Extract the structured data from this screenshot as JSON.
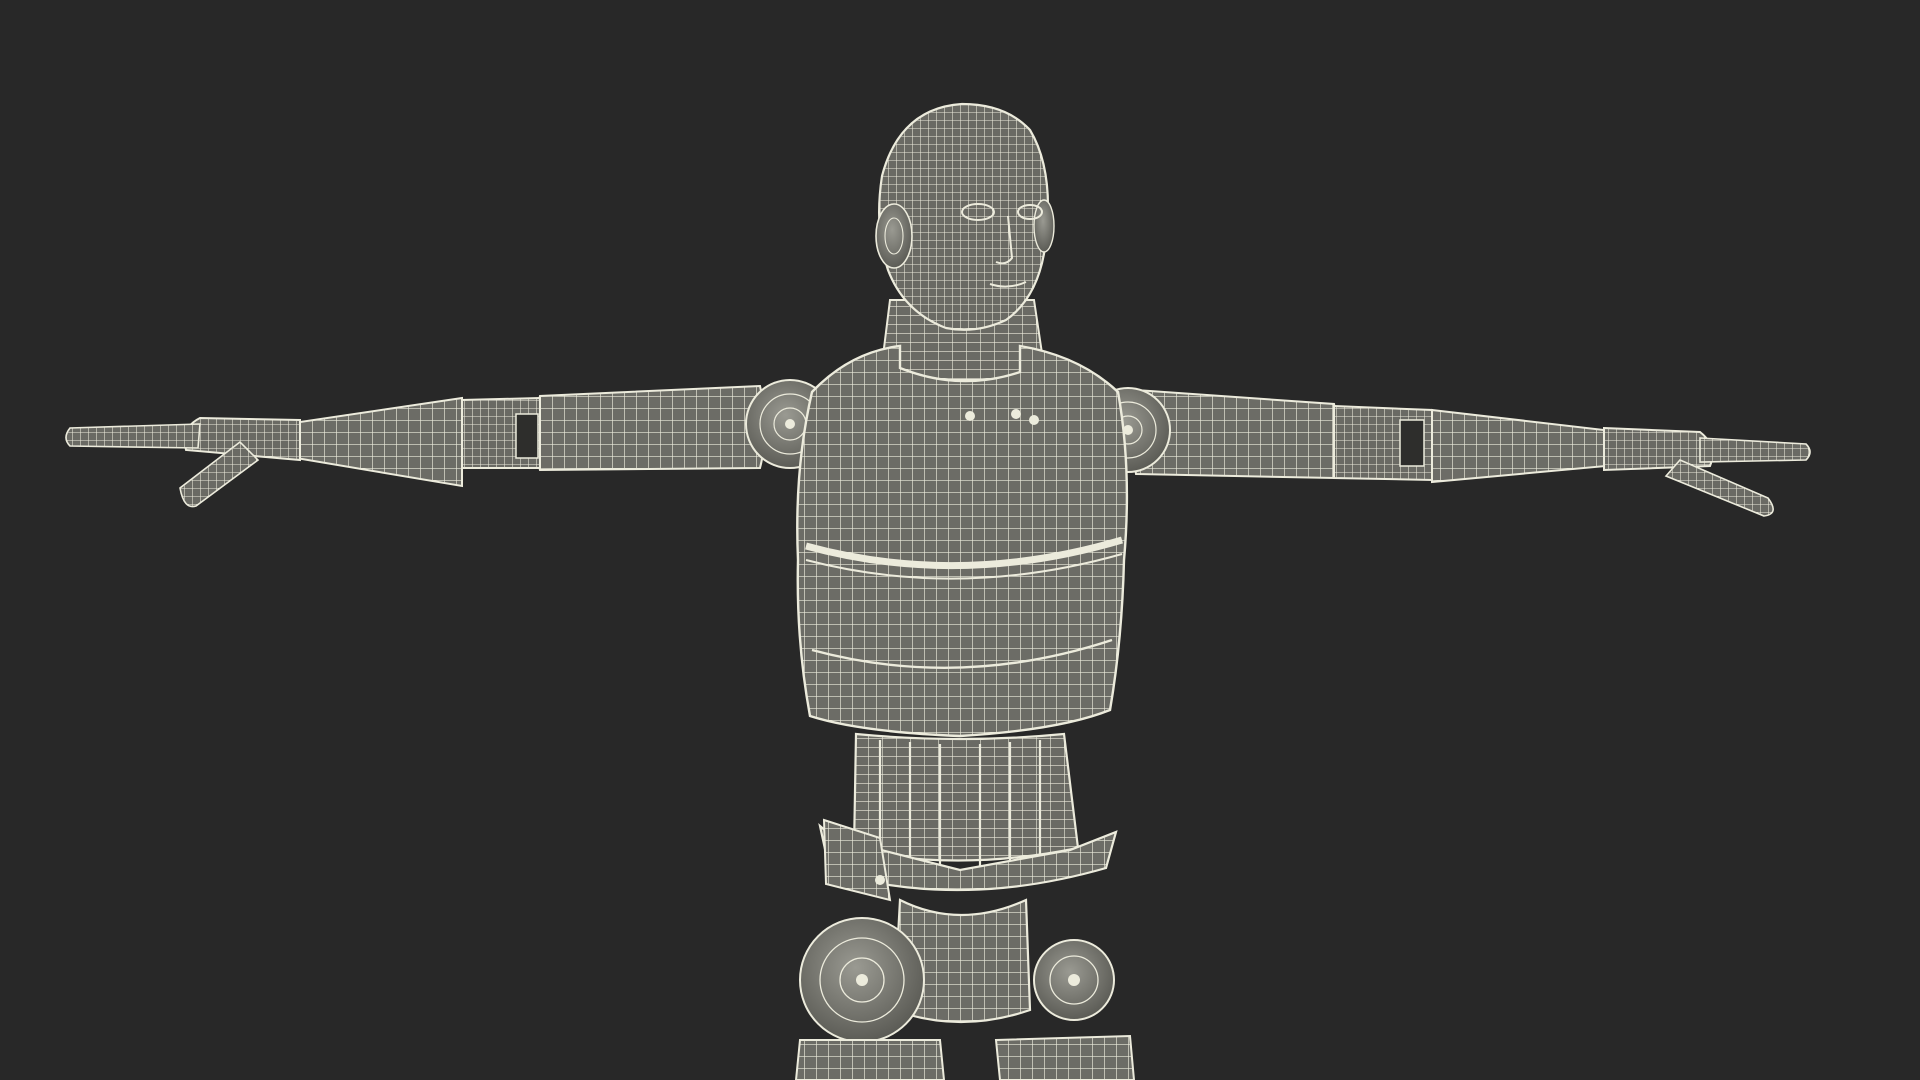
{
  "scene": {
    "subject_icon": "robot-wireframe-icon",
    "pose": "t-pose",
    "colors": {
      "background": "#282828",
      "mesh_fill": "#6f6f69",
      "mesh_fill_dark": "#55554f",
      "wire": "#ecebdc",
      "joint": "#8a8a82"
    }
  }
}
